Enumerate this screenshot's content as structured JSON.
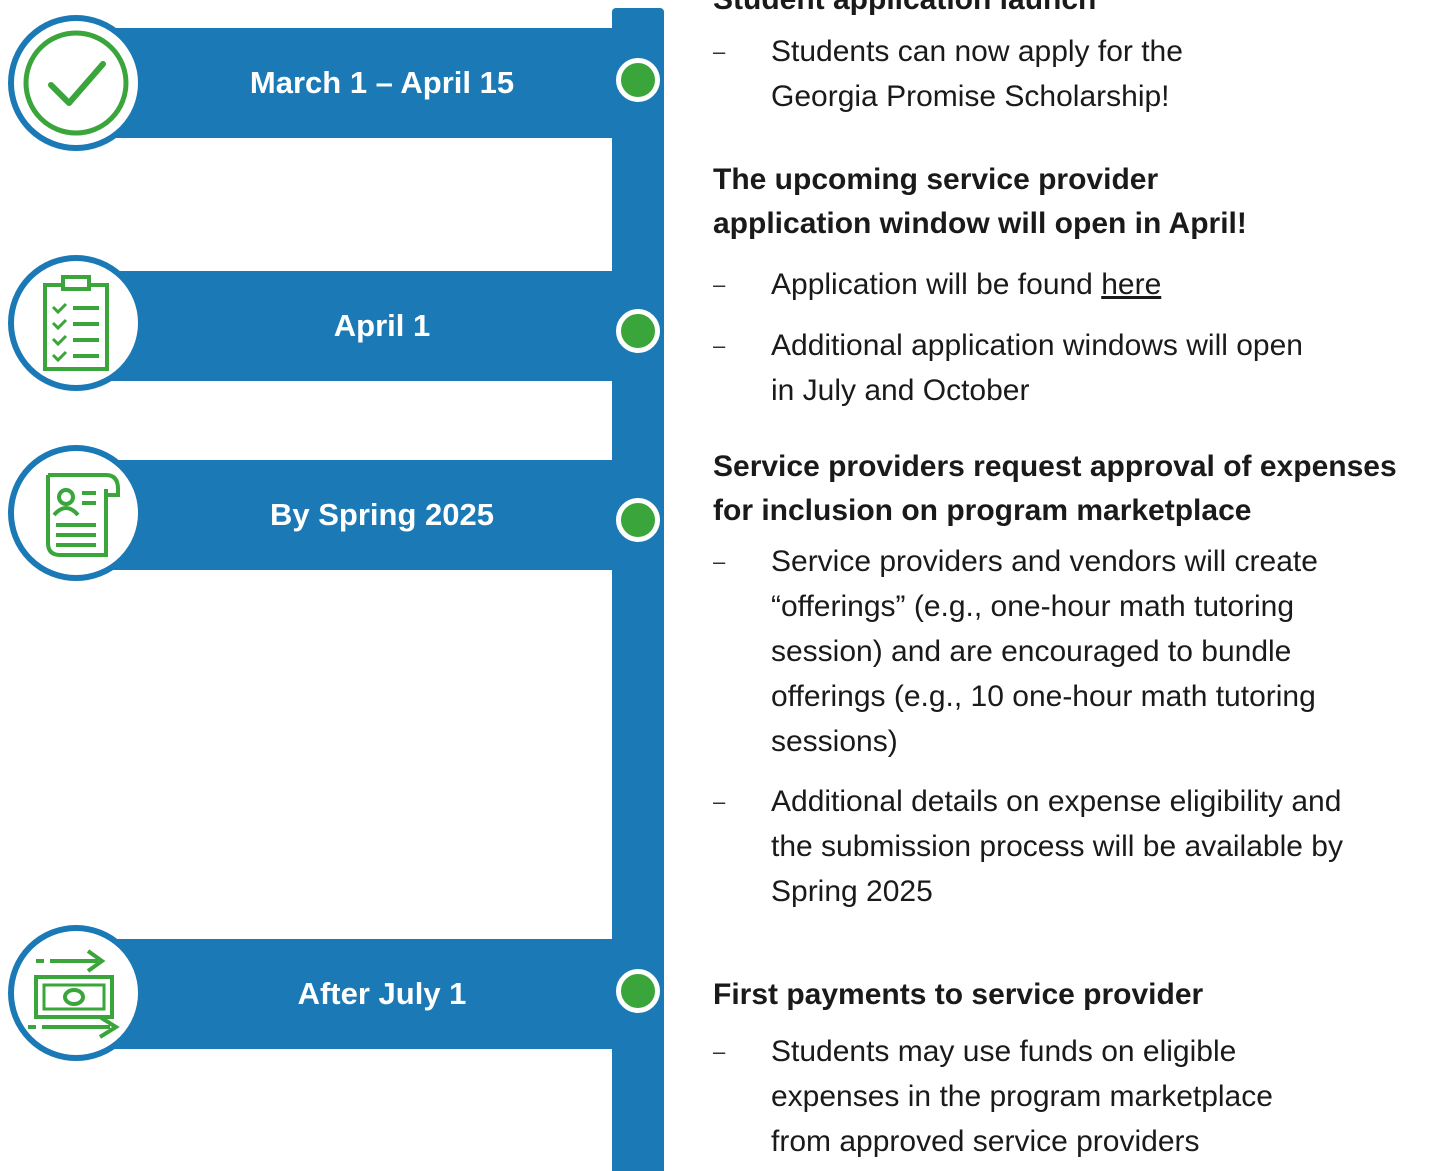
{
  "milestones": [
    {
      "date": "March 1 – April 15",
      "icon": "check-circle-icon"
    },
    {
      "date": "April 1",
      "icon": "clipboard-checklist-icon"
    },
    {
      "date": "By Spring 2025",
      "icon": "document-scroll-icon"
    },
    {
      "date": "After July 1",
      "icon": "money-transfer-icon"
    }
  ],
  "details": {
    "student_launch": {
      "heading": "Student application launch",
      "bullets": [
        {
          "line1": "Students can now apply for the",
          "line2": "Georgia Promise Scholarship!"
        }
      ]
    },
    "provider_window": {
      "heading_line1": "The upcoming service provider",
      "heading_line2": "application window will open in April!",
      "bullet1_prefix": "Application will be found ",
      "bullet1_link": "here",
      "bullet2_line1": "Additional application windows will open",
      "bullet2_line2": "in July and October"
    },
    "expense_approval": {
      "heading_line1": "Service providers request approval of expenses",
      "heading_line2": "for inclusion on program marketplace",
      "bullet1_lines": [
        "Service providers and vendors will create",
        "“offerings” (e.g., one-hour math tutoring",
        "session) and are encouraged to bundle",
        "offerings (e.g., 10 one-hour math tutoring",
        "sessions)"
      ],
      "bullet2_lines": [
        "Additional details on expense eligibility and",
        "the submission process will be available by",
        "Spring 2025"
      ]
    },
    "first_payments": {
      "heading": "First payments to service provider",
      "bullet_lines": [
        "Students may use funds on eligible",
        "expenses in the program marketplace",
        "from approved service providers"
      ]
    }
  },
  "bullet_marker": "–",
  "colors": {
    "timeline_blue": "#1b7ab6",
    "accent_green": "#3aa53a",
    "text": "#1a1a1a"
  }
}
